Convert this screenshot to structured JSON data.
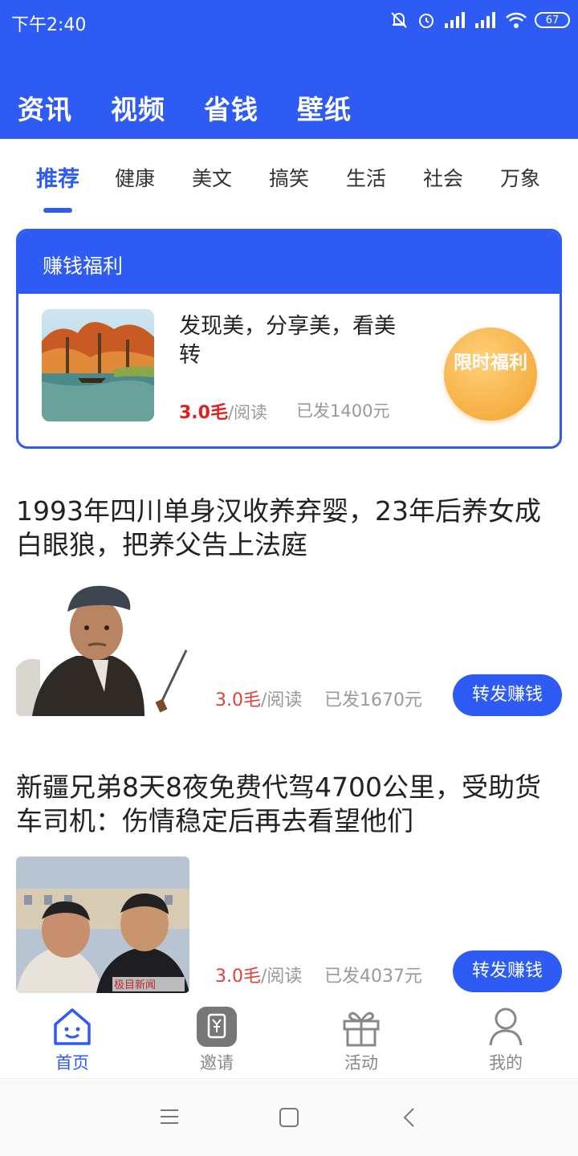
{
  "status_bar": {
    "time": "下午2:40",
    "battery": "67"
  },
  "main_tabs": [
    "资讯",
    "视频",
    "省钱",
    "壁纸"
  ],
  "sub_tabs": [
    "推荐",
    "健康",
    "美文",
    "搞笑",
    "生活",
    "社会",
    "万象"
  ],
  "welfare": {
    "header": "赚钱福利",
    "title": "发现美，分享美，看美转",
    "rate_amount": "3.0毛",
    "rate_unit": "/阅读",
    "paid": "已发1400元",
    "badge": "限时福利"
  },
  "articles": [
    {
      "title": "1993年四川单身汉收养弃婴，23年后养女成白眼狼，把养父告上法庭",
      "rate_amount": "3.0毛",
      "rate_unit": "/阅读",
      "paid": "已发1670元",
      "button": "转发赚钱"
    },
    {
      "title": "新疆兄弟8天8夜免费代驾4700公里，受助货车司机：伤情稳定后再去看望他们",
      "rate_amount": "3.0毛",
      "rate_unit": "/阅读",
      "paid": "已发4037元",
      "button": "转发赚钱",
      "thumb_watermark": "极目新闻"
    }
  ],
  "bottom_nav": [
    "首页",
    "邀请",
    "活动",
    "我的"
  ],
  "colors": {
    "brand": "#2f5bf5",
    "price_red": "#e02020",
    "badge_orange": "#f2a12c"
  }
}
